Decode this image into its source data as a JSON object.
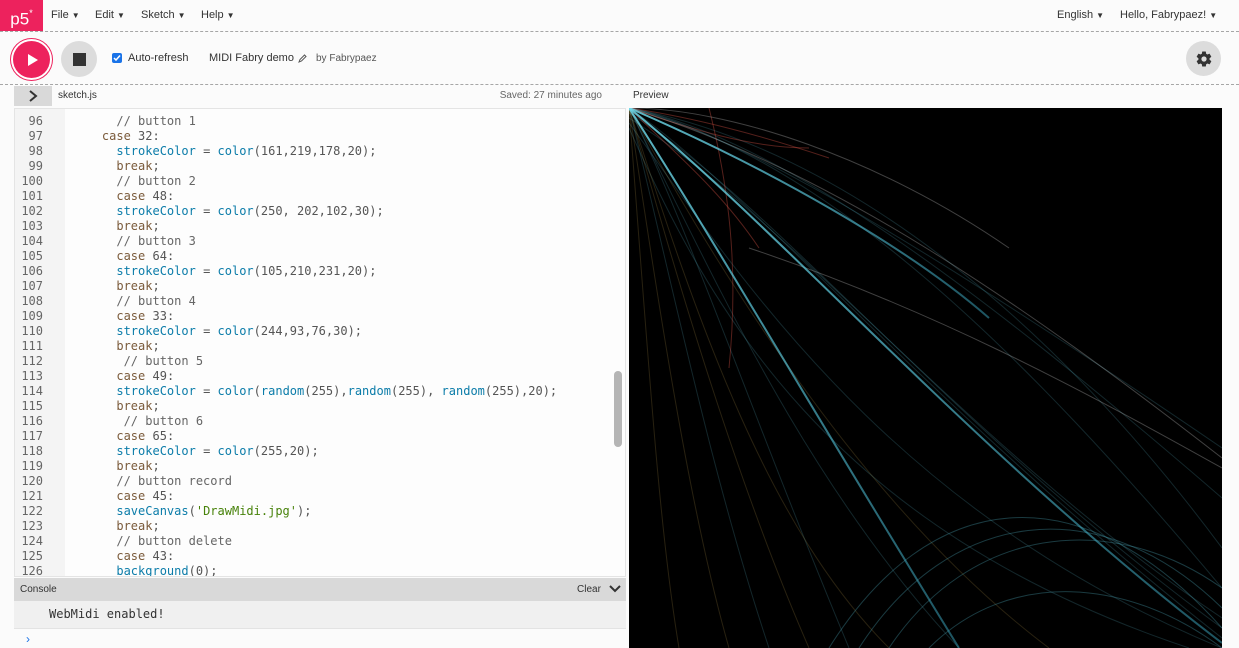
{
  "navbar": {
    "logo": "p5",
    "logo_sup": "*",
    "menus": [
      "File",
      "Edit",
      "Sketch",
      "Help"
    ],
    "language": "English",
    "user_greeting": "Hello, Fabrypaez!"
  },
  "toolbar": {
    "auto_refresh_label": "Auto-refresh",
    "auto_refresh_checked": true,
    "sketch_name": "MIDI Fabry demo",
    "owner": "by Fabrypaez"
  },
  "editor": {
    "file_name": "sketch.js",
    "saved_status": "Saved: 27 minutes ago",
    "lines": [
      {
        "n": "96",
        "text": "      // button 1"
      },
      {
        "n": "97",
        "text": "    case 32:"
      },
      {
        "n": "98",
        "text": "      strokeColor = color(161,219,178,20);"
      },
      {
        "n": "99",
        "text": "      break;"
      },
      {
        "n": "100",
        "text": "      // button 2"
      },
      {
        "n": "101",
        "text": "      case 48:"
      },
      {
        "n": "102",
        "text": "      strokeColor = color(250, 202,102,30);"
      },
      {
        "n": "103",
        "text": "      break;"
      },
      {
        "n": "104",
        "text": "      // button 3"
      },
      {
        "n": "105",
        "text": "      case 64:"
      },
      {
        "n": "106",
        "text": "      strokeColor = color(105,210,231,20);"
      },
      {
        "n": "107",
        "text": "      break;"
      },
      {
        "n": "108",
        "text": "      // button 4"
      },
      {
        "n": "109",
        "text": "      case 33:"
      },
      {
        "n": "110",
        "text": "      strokeColor = color(244,93,76,30);"
      },
      {
        "n": "111",
        "text": "      break;"
      },
      {
        "n": "112",
        "text": "       // button 5"
      },
      {
        "n": "113",
        "text": "      case 49:"
      },
      {
        "n": "114",
        "text": "      strokeColor = color(random(255),random(255), random(255),20);"
      },
      {
        "n": "115",
        "text": "      break;"
      },
      {
        "n": "116",
        "text": "       // button 6"
      },
      {
        "n": "117",
        "text": "      case 65:"
      },
      {
        "n": "118",
        "text": "      strokeColor = color(255,20);"
      },
      {
        "n": "119",
        "text": "      break;"
      },
      {
        "n": "120",
        "text": "      // button record"
      },
      {
        "n": "121",
        "text": "      case 45:"
      },
      {
        "n": "122",
        "text": "      saveCanvas('DrawMidi.jpg');"
      },
      {
        "n": "123",
        "text": "      break;"
      },
      {
        "n": "124",
        "text": "      // button delete"
      },
      {
        "n": "125",
        "text": "      case 43:"
      },
      {
        "n": "126",
        "text": "      background(0);"
      }
    ]
  },
  "console": {
    "title": "Console",
    "clear_label": "Clear",
    "messages": [
      "WebMidi enabled!"
    ],
    "prompt": "›"
  },
  "preview": {
    "label": "Preview",
    "background": "#000000"
  },
  "colors": {
    "accent": "#ed225d",
    "canvas_background": "#000000"
  }
}
